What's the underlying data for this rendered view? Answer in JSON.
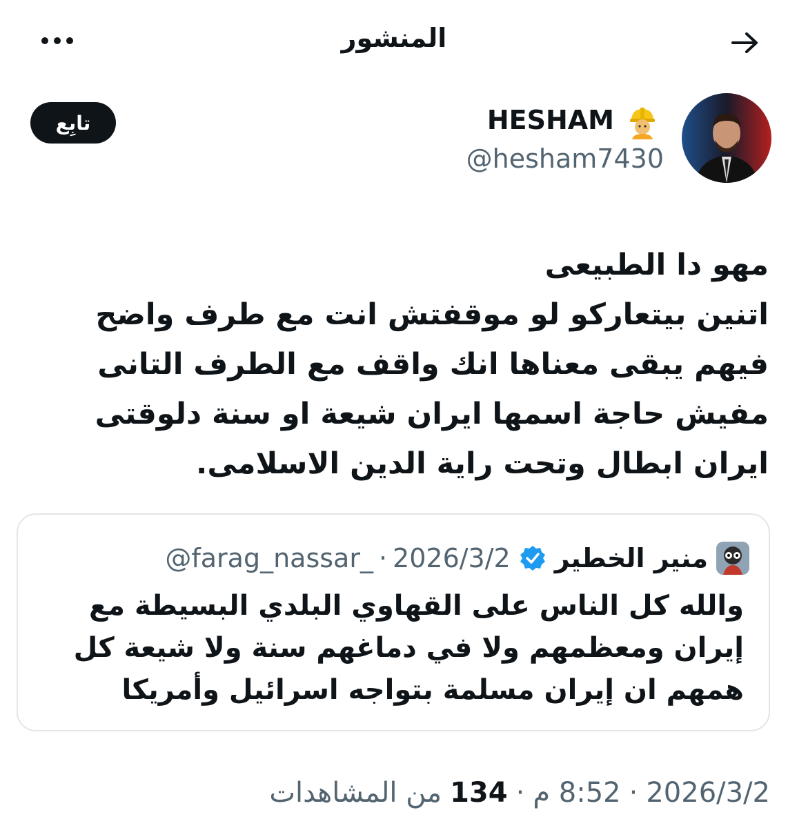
{
  "header": {
    "title": "المنشور",
    "back_icon": "arrow-right-icon",
    "more_icon": "more-horizontal-icon"
  },
  "author": {
    "display_name": "HESHAM",
    "emoji_icon": "construction-worker-icon",
    "handle": "@hesham7430",
    "follow_label": "تابِع"
  },
  "post": {
    "lines": [
      "مهو دا الطبيعى",
      "اتنين بيتعاركو لو موقفتش انت مع طرف واضح",
      "فيهم يبقى معناها انك واقف مع الطرف التانى",
      "مفيش حاجة اسمها ايران شيعة او سنة دلوقتى",
      "ايران ابطال وتحت راية الدين الاسلامى."
    ]
  },
  "quote": {
    "name": "منير الخطير",
    "verified_icon": "verified-badge-icon",
    "handle": "@farag_nassar_",
    "separator": "·",
    "date": "2026/3/2",
    "lines": [
      "والله كل الناس على القهاوي البلدي البسيطة مع",
      "إيران ومعظمهم ولا في دماغهم سنة ولا شيعة كل",
      "همهم ان إيران مسلمة بتواجه اسرائيل وأمريكا"
    ]
  },
  "meta": {
    "date": "2026/3/2",
    "sep1": "·",
    "time": "8:52 م",
    "sep2": "·",
    "views_count": "134",
    "views_label": "من المشاهدات"
  },
  "colors": {
    "text": "#0f1419",
    "secondary": "#536471",
    "verified": "#1d9bf0",
    "border": "#e1e6ea"
  }
}
